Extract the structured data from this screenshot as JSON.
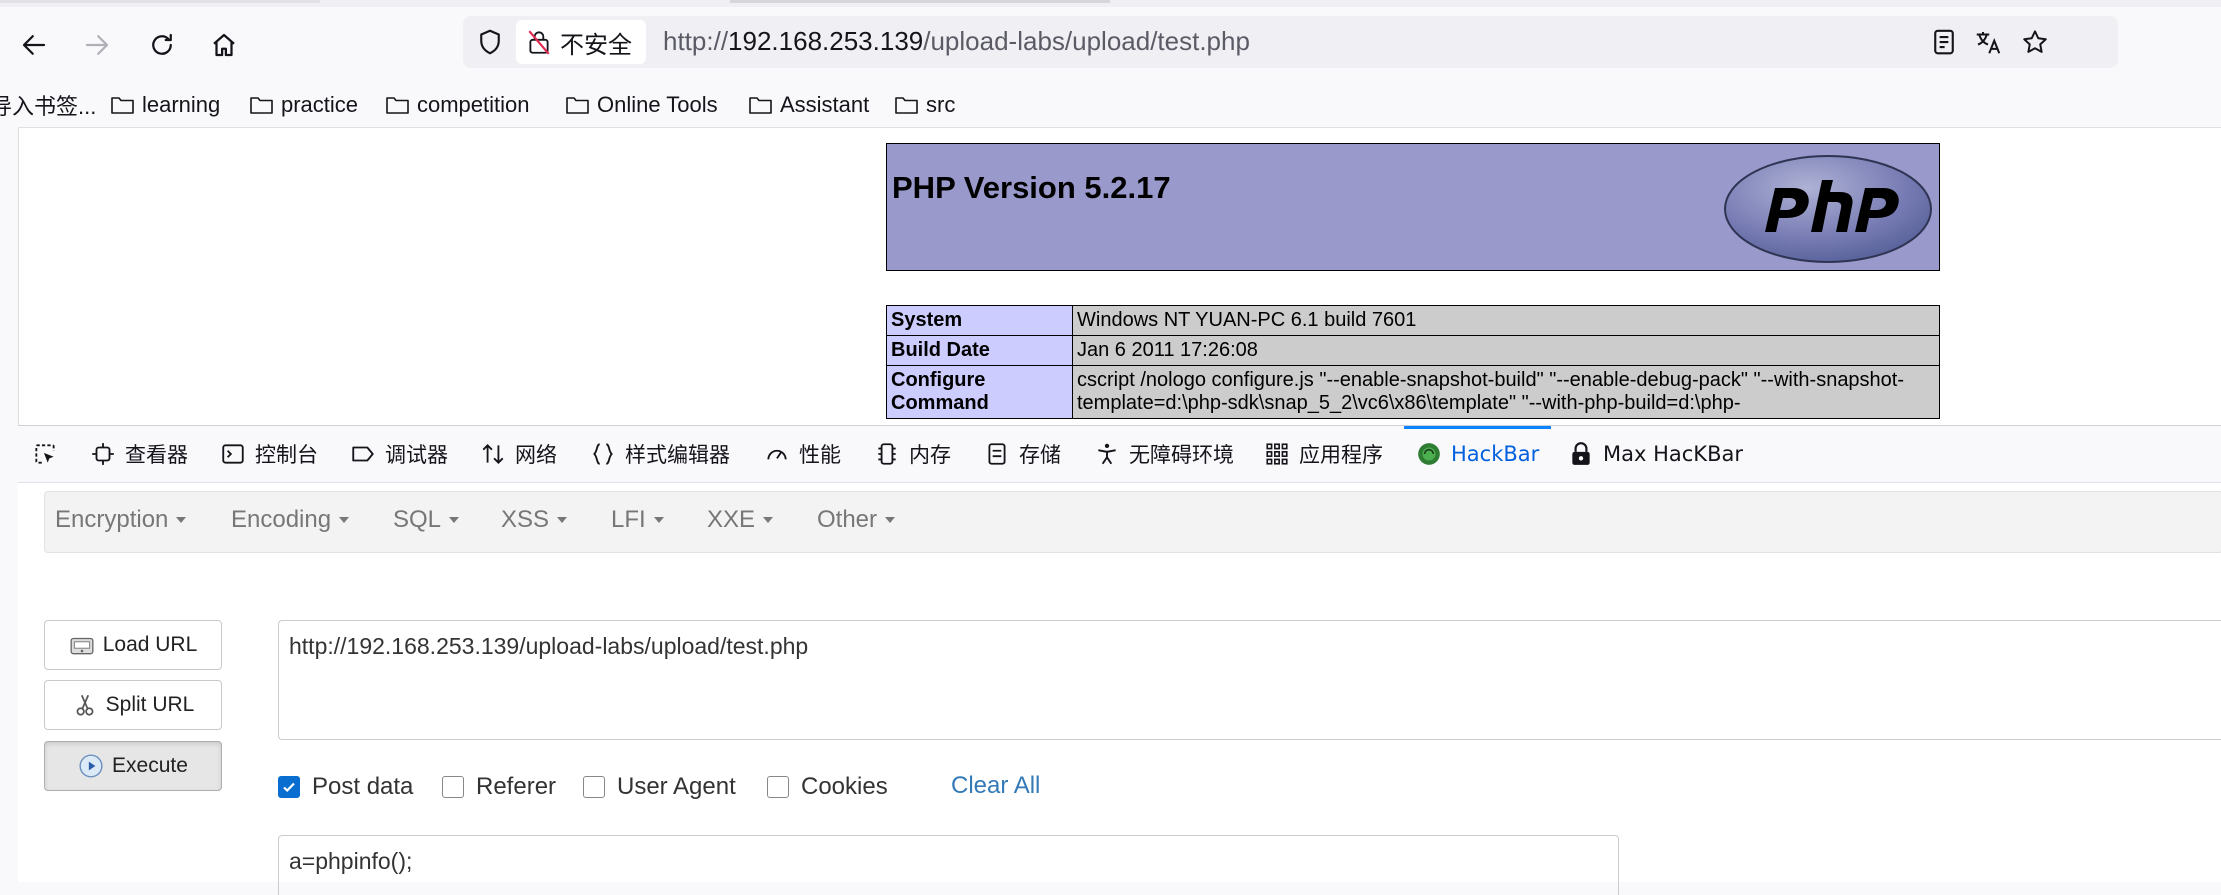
{
  "browser": {
    "security_label": "不安全",
    "url_scheme": "http://",
    "url_host": "192.168.253.139",
    "url_path": "/upload-labs/upload/test.php"
  },
  "bookmarks": [
    {
      "label": "导入书签..."
    },
    {
      "label": "learning"
    },
    {
      "label": "practice"
    },
    {
      "label": "competition"
    },
    {
      "label": "Online Tools"
    },
    {
      "label": "Assistant"
    },
    {
      "label": "src"
    }
  ],
  "phpinfo": {
    "title": "PHP Version 5.2.17",
    "rows": [
      {
        "key": "System",
        "value": "Windows NT YUAN-PC 6.1 build 7601"
      },
      {
        "key": "Build Date",
        "value": "Jan 6 2011 17:26:08"
      },
      {
        "key": "Configure Command",
        "value": "cscript /nologo configure.js \"--enable-snapshot-build\" \"--enable-debug-pack\" \"--with-snapshot-template=d:\\php-sdk\\snap_5_2\\vc6\\x86\\template\" \"--with-php-build=d:\\php-"
      }
    ]
  },
  "devtools": {
    "tabs": [
      {
        "label": "查看器",
        "icon": "inspector-icon"
      },
      {
        "label": "控制台",
        "icon": "console-icon"
      },
      {
        "label": "调试器",
        "icon": "debugger-icon"
      },
      {
        "label": "网络",
        "icon": "network-icon"
      },
      {
        "label": "样式编辑器",
        "icon": "style-editor-icon"
      },
      {
        "label": "性能",
        "icon": "performance-icon"
      },
      {
        "label": "内存",
        "icon": "memory-icon"
      },
      {
        "label": "存储",
        "icon": "storage-icon"
      },
      {
        "label": "无障碍环境",
        "icon": "accessibility-icon"
      },
      {
        "label": "应用程序",
        "icon": "application-icon"
      },
      {
        "label": "HackBar",
        "icon": "hackbar-icon",
        "active": true
      },
      {
        "label": "Max HacKBar",
        "icon": "max-hackbar-icon"
      }
    ],
    "accent_color": "#0060df"
  },
  "hackbar": {
    "menus": [
      "Encryption",
      "Encoding",
      "SQL",
      "XSS",
      "LFI",
      "XXE",
      "Other"
    ],
    "buttons": {
      "load_url": "Load URL",
      "split_url": "Split URL",
      "execute": "Execute"
    },
    "url_value": "http://192.168.253.139/upload-labs/upload/test.php",
    "options": [
      {
        "label": "Post data",
        "checked": true
      },
      {
        "label": "Referer",
        "checked": false
      },
      {
        "label": "User Agent",
        "checked": false
      },
      {
        "label": "Cookies",
        "checked": false
      }
    ],
    "clear_all": "Clear All",
    "post_value": "a=phpinfo();"
  }
}
